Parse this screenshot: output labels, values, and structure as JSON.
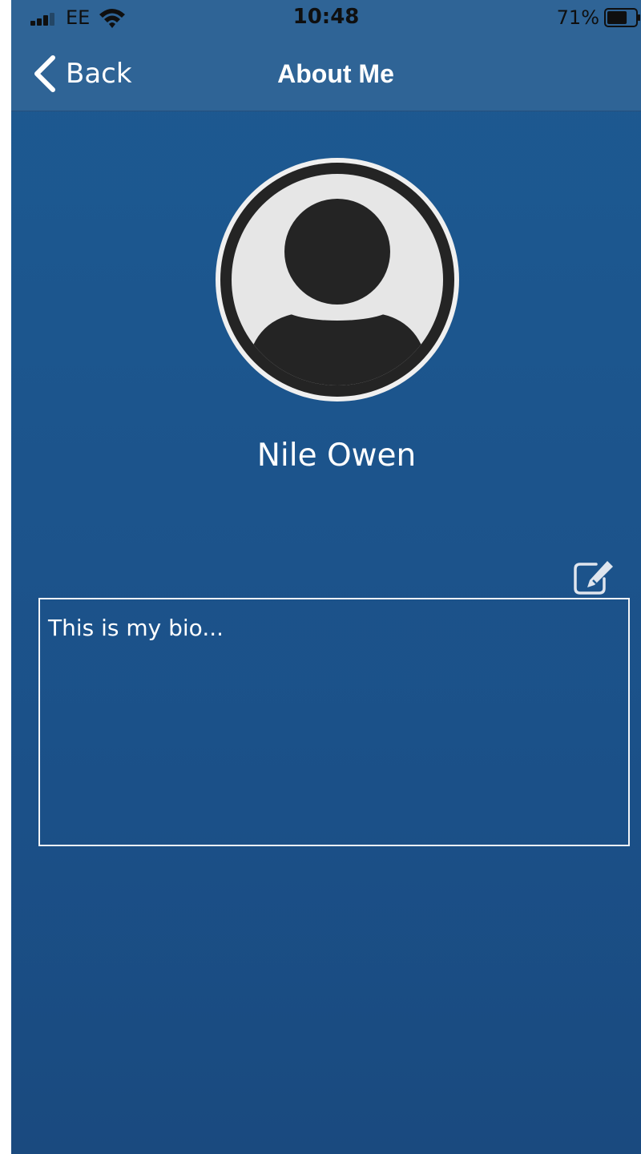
{
  "status_bar": {
    "carrier": "EE",
    "time": "10:48",
    "battery_percent": "71%",
    "battery_level": 0.71,
    "signal_icon": "cellular-signal-icon",
    "wifi_icon": "wifi-icon",
    "battery_icon": "battery-icon"
  },
  "nav": {
    "back_label": "Back",
    "back_icon": "chevron-left-icon",
    "title": "About Me"
  },
  "profile": {
    "avatar_icon": "user-avatar-icon",
    "name": "Nile Owen"
  },
  "bio": {
    "edit_icon": "edit-icon",
    "text": "This is my bio..."
  },
  "colors": {
    "background": "#1d5a92",
    "header": "#2f6496",
    "text": "#ffffff",
    "bio_border": "#f2f4f7"
  }
}
